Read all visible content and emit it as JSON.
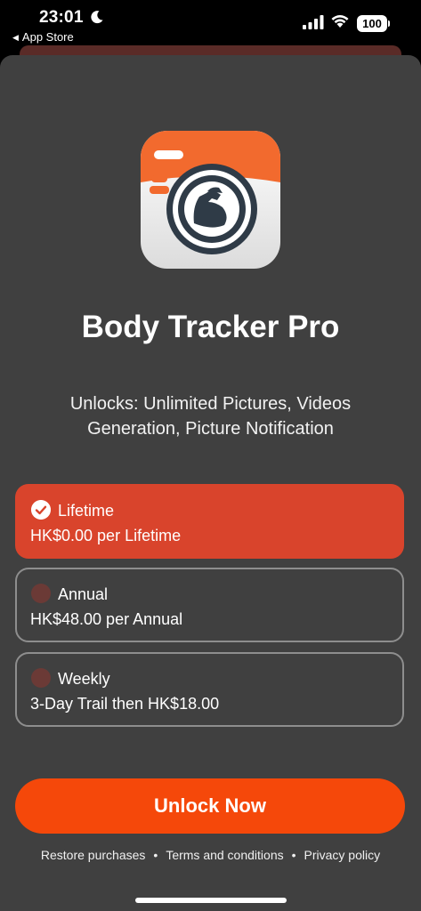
{
  "status_bar": {
    "time": "23:01",
    "back_app": "App Store",
    "battery": "100"
  },
  "app": {
    "name": "Body Tracker Pro",
    "icon": "camera-flexed-arm-icon",
    "description": "Unlocks: Unlimited Pictures, Videos Generation, Picture Notification"
  },
  "plans": [
    {
      "name": "Lifetime",
      "price": "HK$0.00 per Lifetime",
      "selected": true
    },
    {
      "name": "Annual",
      "price": "HK$48.00 per Annual",
      "selected": false
    },
    {
      "name": "Weekly",
      "price": "3-Day Trail then HK$18.00",
      "selected": false
    }
  ],
  "cta": {
    "label": "Unlock Now"
  },
  "footer": {
    "restore": "Restore purchases",
    "terms": "Terms and conditions",
    "privacy": "Privacy policy",
    "separator": "•"
  },
  "colors": {
    "sheet_background": "#404040",
    "selected_plan": "#d9442c",
    "cta": "#f5480a",
    "icon_orange": "#f26a2e"
  }
}
